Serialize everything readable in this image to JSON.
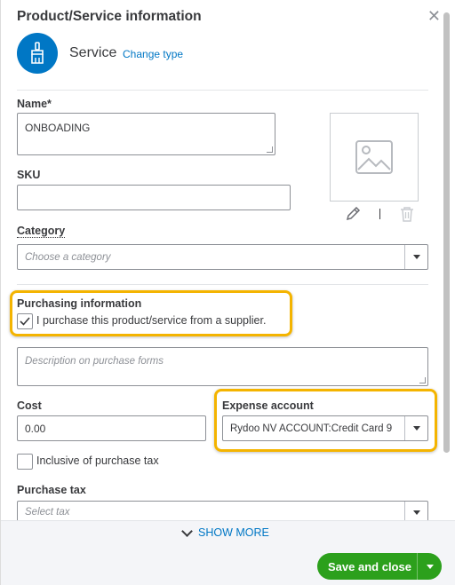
{
  "panel": {
    "title": "Product/Service information",
    "type_label": "Service",
    "change_type": "Change type"
  },
  "form": {
    "name_label": "Name*",
    "name_value": "ONBOADING",
    "sku_label": "SKU",
    "sku_value": "",
    "category_label": "Category",
    "category_placeholder": "Choose a category",
    "purchasing_label": "Purchasing information",
    "purchase_checkbox_label": "I purchase this product/service from a supplier.",
    "purchase_checked": true,
    "purchase_desc_placeholder": "Description on purchase forms",
    "cost_label": "Cost",
    "cost_value": "0.00",
    "expense_label": "Expense account",
    "expense_value": "Rydoo NV ACCOUNT:Credit Card 9",
    "inclusive_label": "Inclusive of purchase tax",
    "inclusive_checked": false,
    "purchase_tax_label": "Purchase tax",
    "purchase_tax_placeholder": "Select tax"
  },
  "footer": {
    "show_more": "SHOW MORE",
    "save_label": "Save and close"
  },
  "colors": {
    "accent": "#0077c5",
    "primary_button": "#2ca01c",
    "highlight": "#f4b400"
  }
}
